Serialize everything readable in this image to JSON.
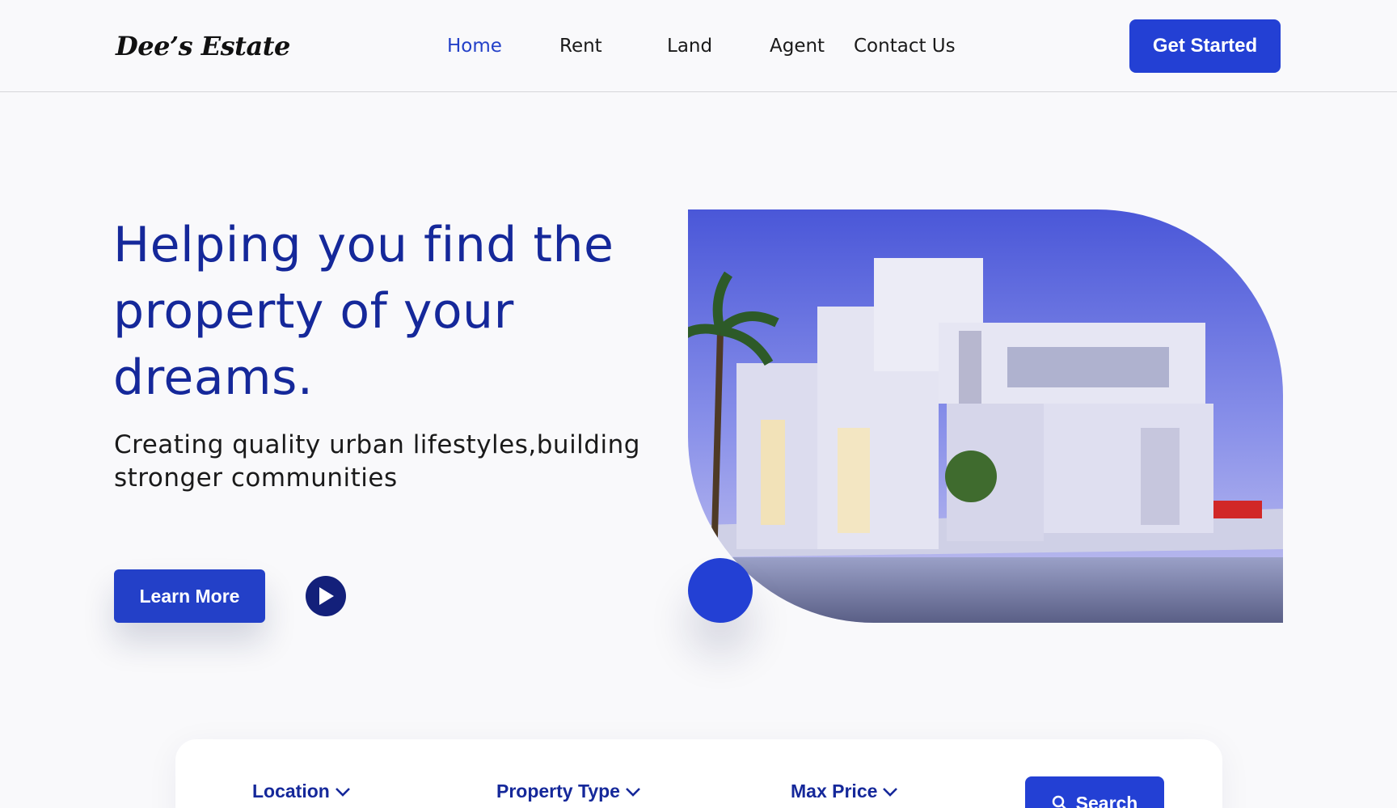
{
  "header": {
    "logo": "Dee’s Estate",
    "nav": [
      "Home",
      "Rent",
      "Land",
      "Agent",
      "Contact Us"
    ],
    "active_nav": "Home",
    "cta_label": "Get Started"
  },
  "hero": {
    "title": "Helping you find the property of your dreams.",
    "subtitle": "Creating quality urban lifestyles,building stronger communities",
    "learn_more_label": "Learn More"
  },
  "search": {
    "filters": [
      "Location",
      "Property Type",
      "Max Price"
    ],
    "button_label": "Search"
  },
  "colors": {
    "accent": "#2340d4",
    "title": "#15289a",
    "play": "#13207a"
  }
}
